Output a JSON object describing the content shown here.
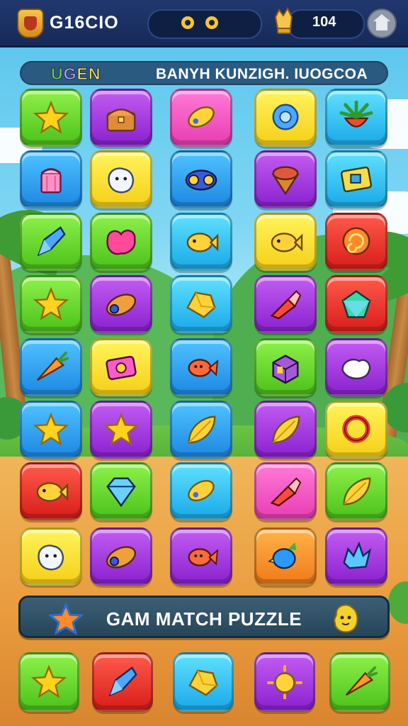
{
  "header": {
    "player_name": "G16CIO",
    "score": "104"
  },
  "subtitle": {
    "left": [
      "U",
      "G",
      "EN"
    ],
    "right": "BANYH KUNZIGH. IUOGCOA"
  },
  "board": {
    "rows": [
      [
        {
          "color": "green",
          "item": "star"
        },
        {
          "color": "purple",
          "item": "chest"
        },
        {
          "color": "pink",
          "item": "candy"
        },
        {
          "color": "yellow",
          "item": "gear"
        },
        {
          "color": "cyan",
          "item": "fruit"
        }
      ],
      [
        {
          "color": "blue",
          "item": "basket"
        },
        {
          "color": "yellow",
          "item": "blob"
        },
        {
          "color": "blue",
          "item": "robot"
        },
        {
          "color": "purple",
          "item": "cone"
        },
        {
          "color": "cyan",
          "item": "box"
        }
      ],
      [
        {
          "color": "green",
          "item": "crystal"
        },
        {
          "color": "green",
          "item": "heart-blob"
        },
        {
          "color": "cyan",
          "item": "fish"
        },
        {
          "color": "yellow",
          "item": "fish"
        },
        {
          "color": "red",
          "item": "swirl"
        }
      ],
      [
        {
          "color": "green",
          "item": "star"
        },
        {
          "color": "purple",
          "item": "capsule"
        },
        {
          "color": "cyan",
          "item": "nugget"
        },
        {
          "color": "purple",
          "item": "rocket"
        },
        {
          "color": "red",
          "item": "gem"
        }
      ],
      [
        {
          "color": "blue",
          "item": "carrot"
        },
        {
          "color": "yellow",
          "item": "camera"
        },
        {
          "color": "blue",
          "item": "candy-fish"
        },
        {
          "color": "green",
          "item": "cube"
        },
        {
          "color": "purple",
          "item": "creature"
        }
      ],
      [
        {
          "color": "blue",
          "item": "star"
        },
        {
          "color": "purple",
          "item": "star"
        },
        {
          "color": "blue",
          "item": "leaf"
        },
        {
          "color": "purple",
          "item": "leaf"
        },
        {
          "color": "yellow",
          "item": "ring"
        }
      ],
      [
        {
          "color": "red",
          "item": "fish"
        },
        {
          "color": "green",
          "item": "diamond"
        },
        {
          "color": "cyan",
          "item": "candy"
        },
        {
          "color": "pink",
          "item": "rocket"
        },
        {
          "color": "green",
          "item": "leaf"
        }
      ],
      [
        {
          "color": "yellow",
          "item": "blob"
        },
        {
          "color": "purple",
          "item": "capsule"
        },
        {
          "color": "purple",
          "item": "candy-fish"
        },
        {
          "color": "orange",
          "item": "bird"
        },
        {
          "color": "purple",
          "item": "splash"
        }
      ]
    ],
    "bottom_row": [
      {
        "color": "green",
        "item": "star"
      },
      {
        "color": "red",
        "item": "crystal"
      },
      {
        "color": "cyan",
        "item": "nugget"
      },
      {
        "color": "purple",
        "item": "sun"
      },
      {
        "color": "green",
        "item": "carrot"
      }
    ]
  },
  "footer": {
    "title": "GAM MATCH PUZZLE"
  },
  "colors": {
    "accent_gold": "#f6c72b",
    "topbar": "#1b315f"
  }
}
